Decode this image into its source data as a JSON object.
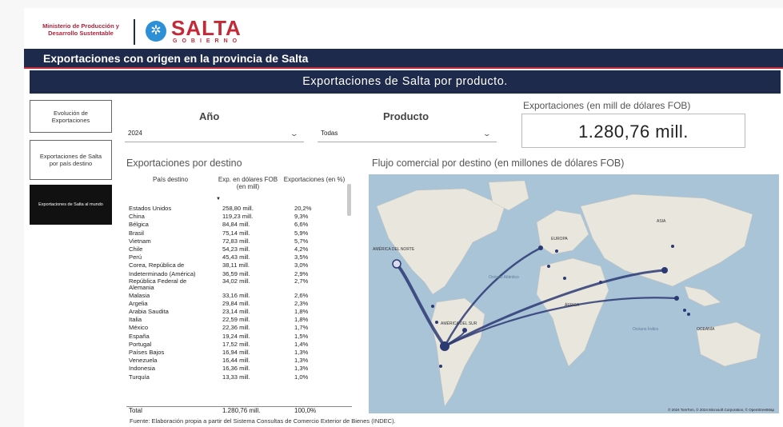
{
  "header": {
    "ministry_line1": "Ministerio de Producción y",
    "ministry_line2": "Desarrollo Sustentable",
    "logo_word": "SALTA",
    "logo_sub": "GOBIERNO",
    "title": "Exportaciones con origen en la provincia de Salta",
    "subtitle": "Exportaciones de Salta por producto."
  },
  "nav": [
    {
      "label": "Evolución de Exportaciones"
    },
    {
      "label": "Exportaciones de Salta por país destino"
    },
    {
      "label": "Exportaciones de Salta al mundo"
    }
  ],
  "filters": {
    "year_label": "Año",
    "year_value": "2024",
    "product_label": "Producto",
    "product_value": "Todas"
  },
  "kpi": {
    "label": "Exportaciones (en mill de dólares FOB)",
    "value": "1.280,76 mill."
  },
  "table": {
    "title": "Exportaciones por destino",
    "col_country": "País destino",
    "col_exports": "Exp. en dólares FOB (en mill)",
    "col_pct": "Exportaciones (en %)",
    "rows": [
      {
        "country": "Estados Unidos",
        "exports": "258,80 mill.",
        "pct": "20,2%"
      },
      {
        "country": "China",
        "exports": "119,23 mill.",
        "pct": "9,3%"
      },
      {
        "country": "Bélgica",
        "exports": "84,84 mill.",
        "pct": "6,6%"
      },
      {
        "country": "Brasil",
        "exports": "75,14 mill.",
        "pct": "5,9%"
      },
      {
        "country": "Vietnam",
        "exports": "72,83 mill.",
        "pct": "5,7%"
      },
      {
        "country": "Chile",
        "exports": "54,23 mill.",
        "pct": "4,2%"
      },
      {
        "country": "Perú",
        "exports": "45,43 mill.",
        "pct": "3,5%"
      },
      {
        "country": "Corea, República de",
        "exports": "38,11 mill.",
        "pct": "3,0%"
      },
      {
        "country": "Indeterminado (América)",
        "exports": "36,59 mill.",
        "pct": "2,9%"
      },
      {
        "country": "República Federal de Alemania",
        "exports": "34,02 mill.",
        "pct": "2,7%"
      },
      {
        "country": "Malasia",
        "exports": "33,16 mill.",
        "pct": "2,6%"
      },
      {
        "country": "Argelia",
        "exports": "29,84 mill.",
        "pct": "2,3%"
      },
      {
        "country": "Arabia Saudita",
        "exports": "23,14 mill.",
        "pct": "1,8%"
      },
      {
        "country": "Italia",
        "exports": "22,59 mill.",
        "pct": "1,8%"
      },
      {
        "country": "México",
        "exports": "22,36 mill.",
        "pct": "1,7%"
      },
      {
        "country": "España",
        "exports": "19,24 mill.",
        "pct": "1,5%"
      },
      {
        "country": "Portugal",
        "exports": "17,52 mill.",
        "pct": "1,4%"
      },
      {
        "country": "Países Bajos",
        "exports": "16,94 mill.",
        "pct": "1,3%"
      },
      {
        "country": "Venezuela",
        "exports": "16,44 mill.",
        "pct": "1,3%"
      },
      {
        "country": "Indonesia",
        "exports": "16,36 mill.",
        "pct": "1,3%"
      },
      {
        "country": "Turquía",
        "exports": "13,33 mill.",
        "pct": "1,0%"
      }
    ],
    "total_label": "Total",
    "total_exports": "1.280,76 mill.",
    "total_pct": "100,0%"
  },
  "map": {
    "title": "Flujo comercial por destino (en millones de dólares FOB)",
    "labels": {
      "north_america": "AMÉRICA DEL NORTE",
      "europe": "EUROPA",
      "asia": "ASIA",
      "africa": "ÁFRICA",
      "south_america": "AMÉRICA DEL SUR",
      "oceania": "OCEANÍA",
      "atlantic": "Océano Atlántico",
      "indian": "Océano Índico"
    },
    "credit": "© 2024 TomTom, © 2024 Microsoft Corporation, © OpenStreetMap"
  },
  "source": "Fuente: Elaboración propia a partir del Sistema Consultas de Comercio Exterior de Bienes (INDEC)."
}
